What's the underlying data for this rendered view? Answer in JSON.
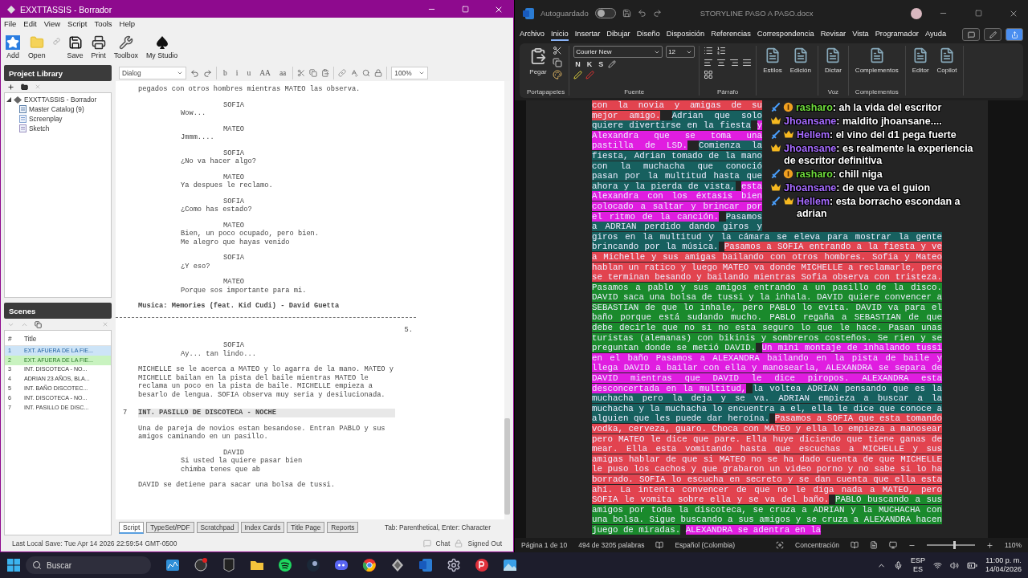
{
  "left_app": {
    "title": "EXXTTASSIS - Borrador",
    "menu": [
      "File",
      "Edit",
      "View",
      "Script",
      "Tools",
      "Help"
    ],
    "toolbar": [
      {
        "kind": "add",
        "label": "Add"
      },
      {
        "kind": "open",
        "label": "Open"
      },
      {
        "kind": "link"
      },
      {
        "kind": "save",
        "label": "Save"
      },
      {
        "kind": "print",
        "label": "Print"
      },
      {
        "kind": "toolbox",
        "label": "Toolbox"
      },
      {
        "kind": "studio",
        "label": "My Studio"
      }
    ],
    "library": {
      "title": "Project Library",
      "tree": [
        {
          "label": "EXXTTASSIS - Borrador",
          "expanded": true,
          "children": [
            {
              "kind": "catalog",
              "label": "Master Catalog (9)"
            },
            {
              "kind": "screenplay",
              "label": "Screenplay"
            },
            {
              "kind": "sketch",
              "label": "Sketch"
            }
          ]
        }
      ]
    },
    "scenes": {
      "title": "Scenes",
      "columns": [
        "#",
        "Title"
      ],
      "rows": [
        {
          "num": "1",
          "title": "EXT. AFUERA DE LA FIE...",
          "selected": true
        },
        {
          "num": "2",
          "title": "EXT. AFUERA DE LA FIE...",
          "selected": false,
          "color": "#c9f3c0"
        },
        {
          "num": "3",
          "title": "INT. DISCOTECA - NO...",
          "selected": false
        },
        {
          "num": "4",
          "title": "ADRIAN 23 AÑOS, BLA...",
          "selected": false
        },
        {
          "num": "5",
          "title": "INT. BAÑO DISCOTEC...",
          "selected": false
        },
        {
          "num": "6",
          "title": "INT. DISCOTECA - NO...",
          "selected": false
        },
        {
          "num": "7",
          "title": "INT. PASILLO DE DISC...",
          "selected": false
        }
      ]
    },
    "editor": {
      "element_type": "Dialog",
      "format_buttons": [
        "b",
        "i",
        "u",
        "AA",
        "aa"
      ],
      "zoom": "100%",
      "script": [
        {
          "kind": "action",
          "text": "pegados con otros hombres mientras MATEO las observa."
        },
        {
          "kind": "character",
          "text": "SOFIA"
        },
        {
          "kind": "dialog",
          "text": "Wow..."
        },
        {
          "kind": "character",
          "text": "MATEO"
        },
        {
          "kind": "dialog",
          "text": "Jmmm...."
        },
        {
          "kind": "character",
          "text": "SOFIA"
        },
        {
          "kind": "dialog",
          "text": "¿No va hacer algo?"
        },
        {
          "kind": "character",
          "text": "MATEO"
        },
        {
          "kind": "dialog",
          "text": "Ya despues le reclamo."
        },
        {
          "kind": "character",
          "text": "SOFIA"
        },
        {
          "kind": "dialog",
          "text": "¿Como has estado?"
        },
        {
          "kind": "character",
          "text": "MATEO"
        },
        {
          "kind": "dialog",
          "text": "Bien, un poco ocupado, pero bien.\nMe alegro que hayas venido"
        },
        {
          "kind": "character",
          "text": "SOFIA"
        },
        {
          "kind": "dialog",
          "text": "¿Y eso?"
        },
        {
          "kind": "character",
          "text": "MATEO"
        },
        {
          "kind": "dialog",
          "text": "Porque sos importante para mi."
        },
        {
          "kind": "music",
          "text": "Musica: Memories (feat. Kid Cudi) - David Guetta"
        },
        {
          "kind": "page_break",
          "text": "5."
        },
        {
          "kind": "character",
          "text": "SOFIA"
        },
        {
          "kind": "dialog",
          "text": "Ay... tan lindo..."
        },
        {
          "kind": "action",
          "text": "MICHELLE se le acerca a MATEO y lo agarra de la mano. MATEO y MICHELLE bailan en la pista del baile mientras MATEO le reclama un poco en la pista de baile. MICHELLE empieza a besarlo de lengua. SOFIA observa muy seria y desilucionada."
        },
        {
          "kind": "heading",
          "number": "7",
          "text": "INT. PASILLO DE DISCOTECA - NOCHE"
        },
        {
          "kind": "action",
          "text": "Una de pareja de novios estan besandose. Entran PABLO y sus amigos caminando en un pasillo."
        },
        {
          "kind": "character",
          "text": "DAVID"
        },
        {
          "kind": "dialog",
          "text": "Si usted la quiere pasar bien\nchimba tenes que ab"
        },
        {
          "kind": "action",
          "text": "DAVID se detiene para sacar una bolsa de tussi."
        }
      ],
      "tabs": [
        {
          "label": "Script",
          "selected": true
        },
        {
          "label": "TypeSet/PDF",
          "selected": false
        },
        {
          "label": "Scratchpad",
          "selected": false
        },
        {
          "label": "Index Cards",
          "selected": false
        },
        {
          "label": "Title Page",
          "selected": false
        },
        {
          "label": "Reports",
          "selected": false
        }
      ],
      "hint": "Tab: Parenthetical, Enter: Character"
    },
    "status": {
      "save": "Last Local Save: Tue Apr 14 2026 22:59:54 GMT-0500",
      "chat": "Chat",
      "account": "Signed Out"
    }
  },
  "word": {
    "autosave": {
      "label": "Autoguardado",
      "on": false
    },
    "title": "STORYLINE PASO A PASO.docx",
    "tabs": [
      {
        "label": "Archivo",
        "selected": false
      },
      {
        "label": "Inicio",
        "selected": true
      },
      {
        "label": "Insertar",
        "selected": false
      },
      {
        "label": "Dibujar",
        "selected": false
      },
      {
        "label": "Diseño",
        "selected": false
      },
      {
        "label": "Disposición",
        "selected": false
      },
      {
        "label": "Referencias",
        "selected": false
      },
      {
        "label": "Correspondencia",
        "selected": false
      },
      {
        "label": "Revisar",
        "selected": false
      },
      {
        "label": "Vista",
        "selected": false
      },
      {
        "label": "Programador",
        "selected": false
      },
      {
        "label": "Ayuda",
        "selected": false
      }
    ],
    "font": {
      "name": "Courier New",
      "size": "12",
      "buttons": [
        "N",
        "K",
        "S"
      ]
    },
    "ribbon_groups": [
      {
        "kind": "clipboard",
        "label": "Portapapeles",
        "buttons": [
          "Pegar"
        ]
      },
      {
        "kind": "font",
        "label": "Fuente"
      },
      {
        "kind": "paragraph",
        "label": "Párrafo"
      },
      {
        "kind": "big",
        "buttons": [
          "Estilos",
          "Edición"
        ]
      },
      {
        "kind": "big",
        "label": "Voz",
        "buttons": [
          "Dictar"
        ]
      },
      {
        "kind": "big",
        "label": "Complementos",
        "buttons": [
          "Complementos"
        ]
      },
      {
        "kind": "big",
        "buttons": [
          "Editor",
          "Copilot"
        ]
      }
    ],
    "document": [
      {
        "color": "#e2434f",
        "text": "con la novia y amigas de su mejor amigo."
      },
      {
        "color": "#17605f",
        "text": "Adrian que solo quiere divertirse en la fiesta"
      },
      {
        "color": "#e01de0",
        "text": "y Alexandra que se toma una pastilla de LSD."
      },
      {
        "color": "#17605f",
        "text": "Comienza la fiesta, Adrian tomado de la mano con la muchacha que conoció pasan por la multitud hasta que ahora y la pierda de vista,"
      },
      {
        "color": "#e01de0",
        "text": "esta Alexandra con los éxtasis bien colocado a saltar y brincar por el ritmo de la canción."
      },
      {
        "color": "#17605f",
        "text": "Pasamos a ADRIAN perdido dando giros y giros en la multitud y la cámara se eleva para mostrar la gente brincando por la música."
      },
      {
        "color": "#e2434f",
        "text": "Pasamos a SOFIA entrando a la fiesta y ve a Michelle y sus amigas bailando con otros hombres. Sofia y Mateo hablan un ratico y luego MATEO va donde MICHELLE a reclamarle, pero se terminan besando y bailando mientras Sofia observa con tristeza."
      },
      {
        "color": "#1a8a2c",
        "text": "Pasamos a pablo y sus amigos entrando a un pasillo de la disco. DAVID saca una bolsa de tussi y la inhala. DAVID quiere convencer a SEBASTIAN de que lo inhale, pero PABLO lo evita. DAVID va para el baño porque está sudando mucho. PABLO regaña a SEBASTIAN de que debe decirle que no si no esta seguro lo que le hace. Pasan unas turistas (alemanas) con bikinis y sombreros costeños. Se rien y se preguntan donde se metió DAVID."
      },
      {
        "color": "#e01de0",
        "text": "Un mini montaje de inhalando tussi en el baño Pasamos a ALEXANDRA bailando en la pista de baile y llega DAVID a bailar con ella y manosearla, ALEXANDRA se separa de DAVID mientras que DAVID le dice piropos. ALEXANDRA esta desconcertada en la multitud,"
      },
      {
        "color": "#17605f",
        "text": "la voltea ADRIAN pensando que es la muchacha pero la deja y se va. ADRIAN empieza a buscar a la muchacha y la muchacha lo encuentra a el, ella le dice que conoce a alguien que les puede dar heroína."
      },
      {
        "color": "#e2434f",
        "text": "Pasamos a SOFIA que esta tomando vodka, cerveza, guaro. Choca con MATEO y ella lo empieza a manosear pero MATEO le dice que pare. Ella huye diciendo que tiene ganas de mear. Ella esta vomitando hasta que escuchas a MICHELLE y sus amigas hablar de que si MATEO no se ha dado cuenta de que MICHELLE le puso los cachos y que grabaron un video porno y no sabe si lo ha borrado. SOFIA lo escucha en secreto y se dan cuenta que ella esta ahí. La intenta convencer de que no le diga nada a MATEO, pero SOFIA le vomita sobre ella y se va del baño."
      },
      {
        "color": "#1a8a2c",
        "text": "PABLO buscando a sus amigos por toda la discoteca, se cruza a ADRIAN y la MUCHACHA con una bolsa. Sigue buscando a sus amigos y se cruza a ALEXANDRA hacen juego de miradas."
      },
      {
        "color": "#e01de0",
        "text": "ALEXANDRA se adentra en la"
      }
    ],
    "status": {
      "page": "Página 1 de 10",
      "words": "494 de 3205 palabras",
      "language": "Español (Colombia)",
      "focus": "Concentración",
      "zoom": "110%",
      "zoom_slider": {
        "level": 0.55
      }
    }
  },
  "chat": [
    {
      "user": "rasharo",
      "separator": ":",
      "color": "#6fdc3c",
      "badges": [
        {
          "kind": "sword"
        },
        {
          "kind": "one"
        }
      ],
      "text": "ah la vida del escritor"
    },
    {
      "user": "Jhoansane",
      "separator": ":",
      "color": "#a66bff",
      "badges": [
        {
          "kind": "crown"
        }
      ],
      "text": "maldito jhoansane...."
    },
    {
      "user": "Hellem",
      "separator": ":",
      "color": "#a66bff",
      "badges": [
        {
          "kind": "sword"
        },
        {
          "kind": "crown"
        }
      ],
      "text": "el vino del d1 pega fuerte"
    },
    {
      "user": "Jhoansane",
      "separator": ":",
      "color": "#a66bff",
      "badges": [
        {
          "kind": "crown"
        }
      ],
      "text": "es realmente la experiencia de escritor definitiva"
    },
    {
      "user": "rasharo",
      "separator": ":",
      "color": "#6fdc3c",
      "badges": [
        {
          "kind": "sword"
        },
        {
          "kind": "one"
        }
      ],
      "text": "chill niga"
    },
    {
      "user": "Jhoansane",
      "separator": ":",
      "color": "#a66bff",
      "badges": [
        {
          "kind": "crown"
        }
      ],
      "text": "de que va el guion"
    },
    {
      "user": "Hellem",
      "separator": ":",
      "color": "#a66bff",
      "badges": [
        {
          "kind": "sword"
        },
        {
          "kind": "crown"
        }
      ],
      "text": "esta borracho escondan a adrian"
    }
  ],
  "taskbar": {
    "search": "Buscar",
    "lang": "ESP",
    "layout": "ES",
    "time": "11:00 p. m.",
    "date": "14/04/2026"
  }
}
